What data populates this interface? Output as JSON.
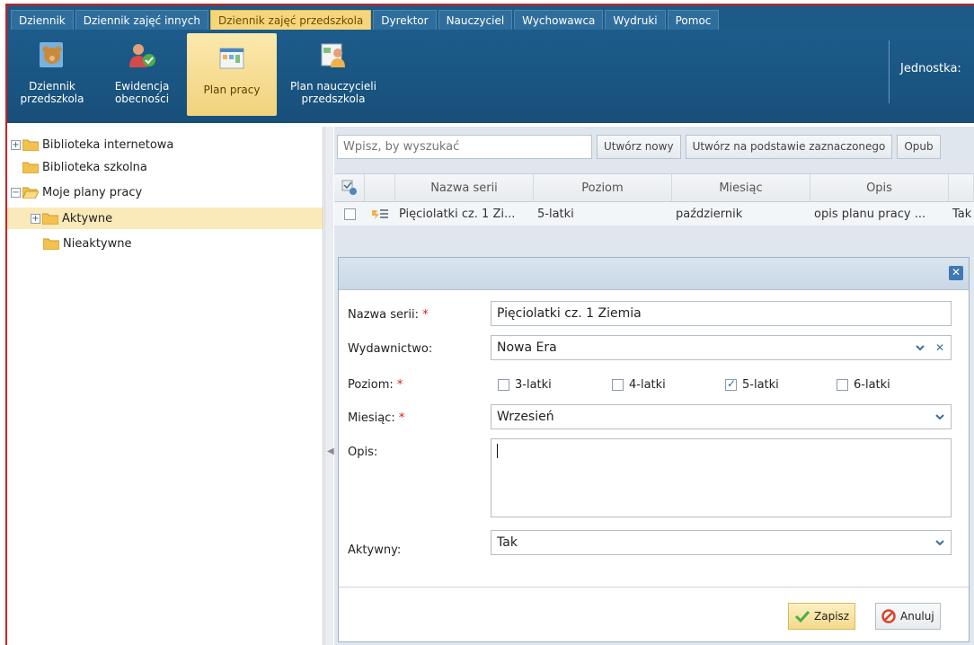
{
  "menu": {
    "tabs": [
      "Dziennik",
      "Dziennik zajęć innych",
      "Dziennik zajęć przedszkola",
      "Dyrektor",
      "Nauczyciel",
      "Wychowawca",
      "Wydruki",
      "Pomoc"
    ],
    "active": "Dziennik zajęć przedszkola"
  },
  "ribbon": {
    "buttons": [
      {
        "label": "Dziennik\nprzedszkola",
        "icon": "teddy-bear-icon"
      },
      {
        "label": "Ewidencja\nobecności",
        "icon": "people-check-icon"
      },
      {
        "label": "Plan pracy",
        "icon": "calendar-plan-icon"
      },
      {
        "label": "Plan nauczycieli\nprzedszkola",
        "icon": "teacher-plan-icon"
      }
    ],
    "active": "Plan pracy",
    "jednostka_label": "Jednostka:"
  },
  "tree": {
    "items": [
      {
        "label": "Biblioteka internetowa",
        "expander": "+"
      },
      {
        "label": "Biblioteka szkolna",
        "expander": ""
      },
      {
        "label": "Moje plany pracy",
        "expander": "−"
      },
      {
        "label": "Aktywne",
        "expander": "+"
      },
      {
        "label": "Nieaktywne",
        "expander": ""
      }
    ],
    "selected": "Aktywne"
  },
  "toolbar": {
    "search_placeholder": "Wpisz, by wyszukać",
    "buttons": [
      "Utwórz nowy",
      "Utwórz na podstawie zaznaczonego",
      "Opub"
    ]
  },
  "grid": {
    "columns": [
      "Nazwa serii",
      "Poziom",
      "Miesiąc",
      "Opis",
      ""
    ],
    "rows": [
      {
        "nazwa": "Pięciolatki cz. 1 Zi...",
        "poziom": "5-latki",
        "miesiac": "październik",
        "opis": "opis planu pracy ...",
        "aktywny": "Tak"
      }
    ]
  },
  "dialog": {
    "close_label": "✕",
    "fields": {
      "nazwa_label": "Nazwa serii:",
      "nazwa_value": "Pięciolatki cz. 1 Ziemia",
      "wydawnictwo_label": "Wydawnictwo:",
      "wydawnictwo_value": "Nowa Era",
      "poziom_label": "Poziom:",
      "poziom_options": [
        {
          "label": "3-latki",
          "checked": false
        },
        {
          "label": "4-latki",
          "checked": false
        },
        {
          "label": "5-latki",
          "checked": true
        },
        {
          "label": "6-latki",
          "checked": false
        }
      ],
      "miesiac_label": "Miesiąc:",
      "miesiac_value": "Wrzesień",
      "opis_label": "Opis:",
      "opis_value": "",
      "aktywny_label": "Aktywny:",
      "aktywny_value": "Tak"
    },
    "required_mark": "*",
    "save_label": "Zapisz",
    "cancel_label": "Anuluj"
  },
  "colors": {
    "menu_bg": "#1d5a86",
    "active_tab": "#f6d67d",
    "frame_red": "#cc1f1f",
    "selection": "#fbeab9"
  }
}
